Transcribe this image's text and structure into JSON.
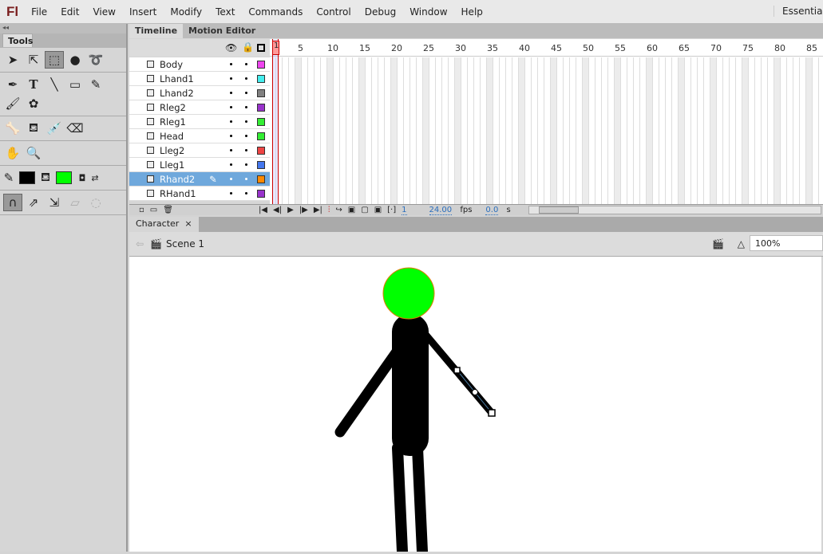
{
  "app": {
    "logo": "Fl",
    "workspace": "Essentials"
  },
  "menu": [
    "File",
    "Edit",
    "View",
    "Insert",
    "Modify",
    "Text",
    "Commands",
    "Control",
    "Debug",
    "Window",
    "Help"
  ],
  "tools": {
    "title": "Tools",
    "stroke_color": "#000000",
    "fill_color": "#00ff00"
  },
  "timeline": {
    "tabs": [
      "Timeline",
      "Motion Editor"
    ],
    "layers": [
      {
        "name": "Body",
        "color": "#ee44ee"
      },
      {
        "name": "Lhand1",
        "color": "#44eeee"
      },
      {
        "name": "Lhand2",
        "color": "#808080"
      },
      {
        "name": "Rleg2",
        "color": "#9933cc"
      },
      {
        "name": "Rleg1",
        "color": "#33ee33"
      },
      {
        "name": "Head",
        "color": "#33ee33"
      },
      {
        "name": "Lleg2",
        "color": "#ee4444"
      },
      {
        "name": "Lleg1",
        "color": "#4477ee"
      },
      {
        "name": "Rhand2",
        "color": "#ff8800",
        "selected": true
      },
      {
        "name": "RHand1",
        "color": "#9933cc"
      }
    ],
    "frame_numbers": [
      "1",
      "5",
      "10",
      "15",
      "20",
      "25",
      "30",
      "35",
      "40",
      "45",
      "50",
      "55",
      "60",
      "65",
      "70",
      "75",
      "80",
      "85"
    ],
    "current_frame": "1",
    "fps": "24.00",
    "fps_unit": "fps",
    "time": "0.0",
    "time_unit": "s"
  },
  "document": {
    "tab": "Character",
    "close": "×",
    "scene": "Scene 1",
    "zoom": "100%"
  }
}
